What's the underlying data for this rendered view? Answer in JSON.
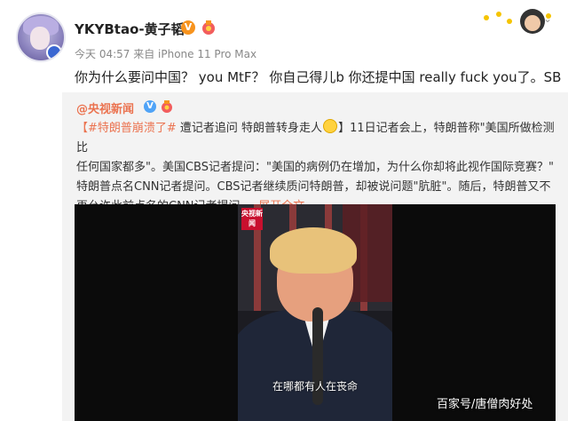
{
  "post": {
    "username": "YKYBtao-黄子韬",
    "verified_badge": "V",
    "meta": "今天 04:57 来自 iPhone 11 Pro Max",
    "text": "你为什么要问中国？ you MtF？ 你自己得儿b 你还提中国 really fuck you了。SB"
  },
  "repost": {
    "user": "@央视新闻",
    "verified_badge": "V",
    "hashtag": "【#特朗普崩溃了#",
    "line1_a": " 遭记者追问 特朗普转身走人",
    "line1_b": "】11日记者会上，特朗普称\"美国所做检测比",
    "line2": "任何国家都多\"。美国CBS记者提问：\"美国的病例仍在增加，为什么你却将此视作国际竞赛？\"",
    "line3": "特朗普点名CNN记者提问。CBS记者继续质问特朗普，却被说问题\"肮脏\"。随后，特朗普又不",
    "line4": "再允许此前点名的CNN记者提问 ...",
    "expand_link": "展开全文",
    "expand_icon": "chevron-down"
  },
  "video": {
    "channel_logo": "央视新闻",
    "subtitle": "在哪都有人在丧命"
  },
  "watermark": "百家号/唐僧肉好处",
  "colors": {
    "link": "#eb7350",
    "repost_bg": "#f3f3f3",
    "verified": "#f7931e"
  }
}
